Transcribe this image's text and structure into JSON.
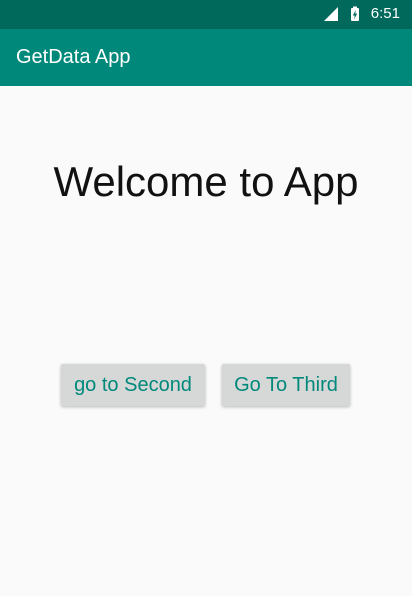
{
  "status_bar": {
    "time": "6:51",
    "icons": [
      "cellular-signal-icon",
      "battery-charging-icon"
    ],
    "background": "#00695c"
  },
  "app_bar": {
    "title": "GetData App",
    "background": "#00897b"
  },
  "main": {
    "welcome_text": "Welcome to App",
    "buttons": [
      {
        "label": "go to Second"
      },
      {
        "label": "Go To Third"
      }
    ],
    "button_text_color": "#00897b",
    "button_background": "#d6d7d7"
  }
}
